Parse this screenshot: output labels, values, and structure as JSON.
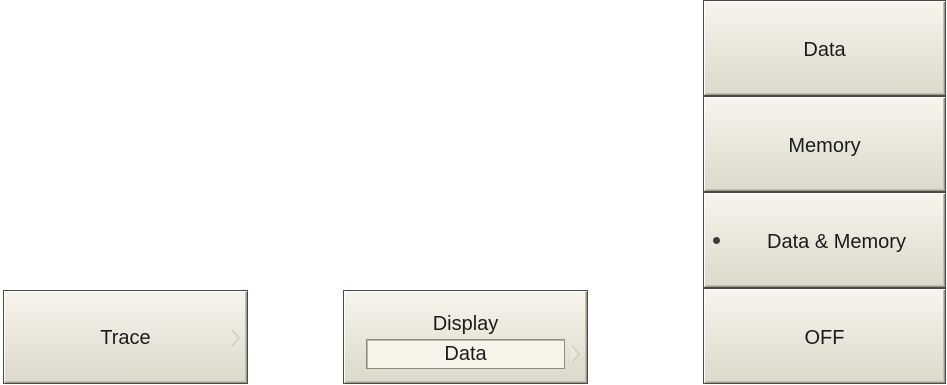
{
  "trace_key": {
    "label": "Trace"
  },
  "display_key": {
    "label": "Display",
    "value": "Data"
  },
  "display_menu": {
    "items": [
      {
        "label": "Data",
        "selected": false
      },
      {
        "label": "Memory",
        "selected": false
      },
      {
        "label": "Data & Memory",
        "selected": true
      },
      {
        "label": "OFF",
        "selected": false
      }
    ]
  }
}
